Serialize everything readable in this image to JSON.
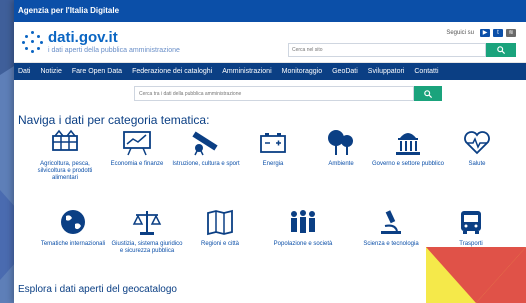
{
  "agency_bar": {
    "text": "Agenzia per l'Italia Digitale"
  },
  "header": {
    "logo_title": "dati.gov.it",
    "logo_subtitle": "i dati aperti della pubblica amministrazione",
    "social_label": "Seguici su",
    "search_placeholder": "Cerca nel sito",
    "search_icon": "search-icon"
  },
  "nav": {
    "items": [
      "Dati",
      "Notizie",
      "Fare Open Data",
      "Federazione dei cataloghi",
      "Amministrazioni",
      "Monitoraggio",
      "GeoDati",
      "Sviluppatori",
      "Contatti"
    ]
  },
  "main_search": {
    "placeholder": "Cerca tra i dati della pubblica amministrazione"
  },
  "categories_title": "Naviga i dati per categoria tematica:",
  "categories": [
    {
      "label": "Agricoltura, pesca, silvicoltura e prodotti alimentari",
      "icon": "tractor-icon"
    },
    {
      "label": "Economia e finanze",
      "icon": "chart-board-icon"
    },
    {
      "label": "Istruzione, cultura e sport",
      "icon": "diploma-icon"
    },
    {
      "label": "Energia",
      "icon": "battery-icon"
    },
    {
      "label": "Ambiente",
      "icon": "trees-icon"
    },
    {
      "label": "Governo e settore pubblico",
      "icon": "government-building-icon"
    },
    {
      "label": "Salute",
      "icon": "heart-pulse-icon"
    },
    {
      "label": "Tematiche internazionali",
      "icon": "globe-icon"
    },
    {
      "label": "Giustizia, sistema giuridico e sicurezza pubblica",
      "icon": "scales-icon"
    },
    {
      "label": "Regioni e città",
      "icon": "map-icon"
    },
    {
      "label": "Popolazione e società",
      "icon": "people-icon"
    },
    {
      "label": "Scienza e tecnologia",
      "icon": "microscope-icon"
    },
    {
      "label": "Trasporti",
      "icon": "bus-icon"
    }
  ],
  "geo_title": "Esplora i dati aperti del geocatalogo",
  "colors": {
    "primary": "#0b4fa8",
    "nav": "#0b3f84",
    "accent": "#1aa37c"
  }
}
